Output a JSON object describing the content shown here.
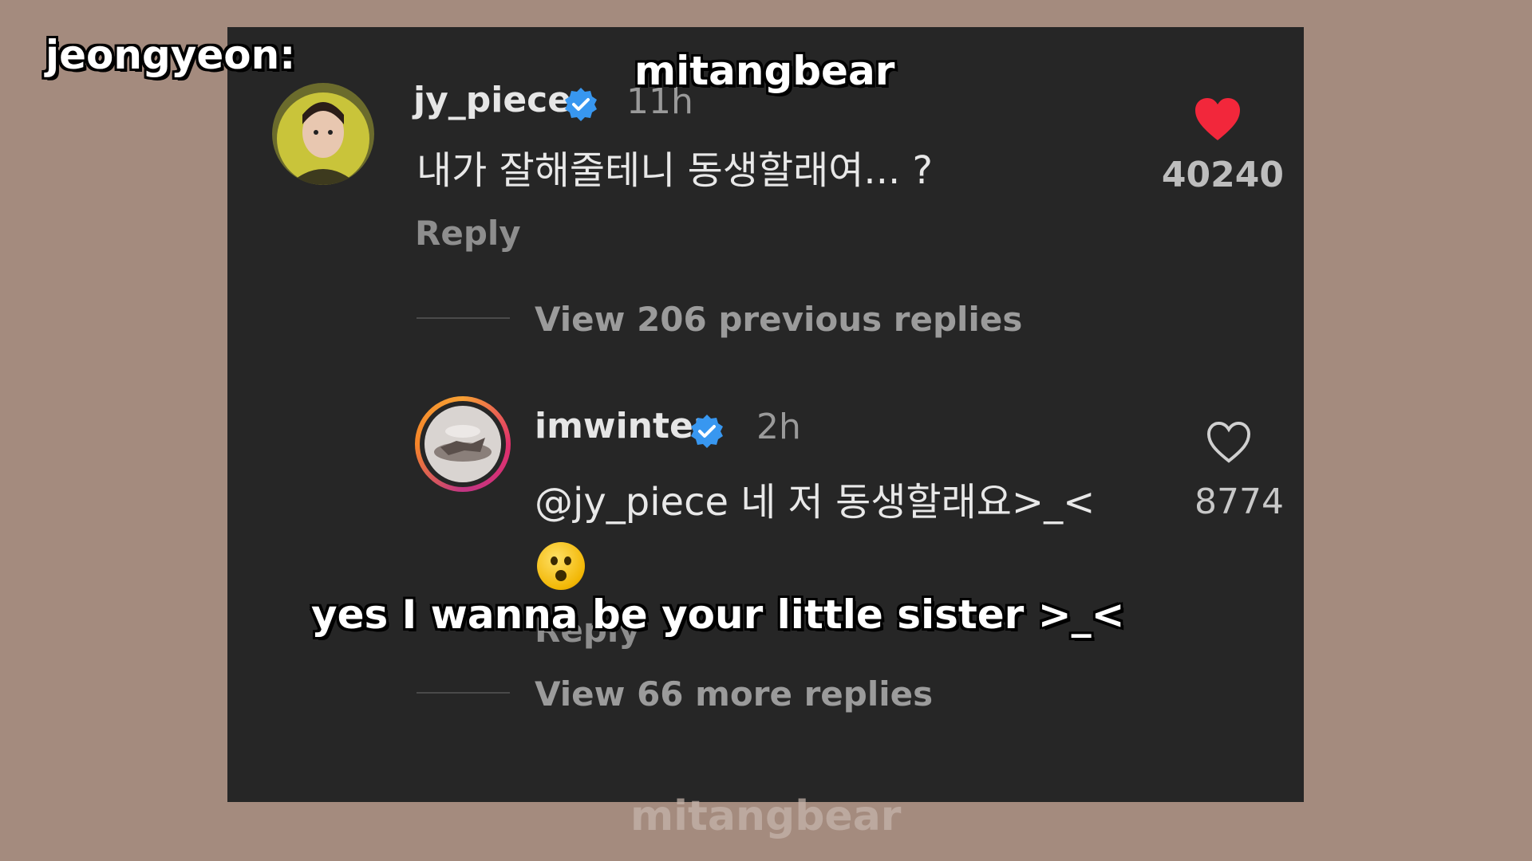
{
  "overlays": {
    "speaker_label": "jeongyeon:",
    "watermark_top": "mitangbear",
    "subtitle": "yes I wanna be your little sister >_<",
    "watermark_bottom": "mitangbear"
  },
  "comment": {
    "username": "jy_piece",
    "verified": true,
    "time": "11h",
    "text": "내가 잘해줄테니 동생할래여... ?",
    "reply_label": "Reply",
    "liked": true,
    "like_count": "40240",
    "view_previous_replies": "View 206 previous replies"
  },
  "reply": {
    "username": "imwinter",
    "verified": true,
    "time": "2h",
    "text": "@jy_piece 네 저 동생할래요>_<",
    "emoji": "shocked-face-emoji",
    "reply_label": "Reply",
    "liked": false,
    "like_count": "8774",
    "view_more_replies": "View 66 more replies"
  },
  "colors": {
    "background": "#a48b7e",
    "panel": "#262626",
    "like_red": "#f2273b",
    "verified_blue": "#3897f0"
  }
}
